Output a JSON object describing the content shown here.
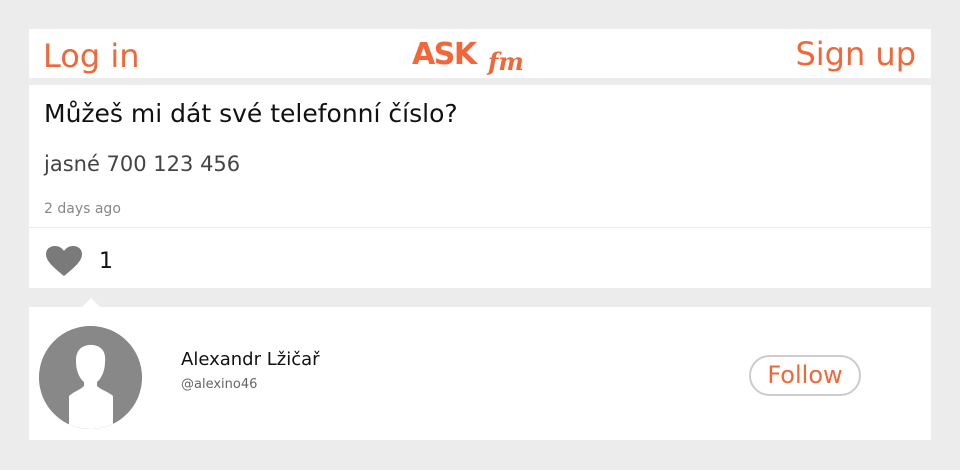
{
  "header": {
    "login_label": "Log in",
    "signup_label": "Sign up",
    "logo_text_ask": "ASK",
    "logo_text_fm": "fm"
  },
  "post": {
    "question": "Můžeš mi dát své telefonní číslo?",
    "answer": "jasné 700 123 456",
    "time_ago": "2 days ago",
    "like_count": "1"
  },
  "user": {
    "name": "Alexandr Lžičař",
    "handle": "@alexino46",
    "follow_label": "Follow"
  },
  "colors": {
    "brand": "#f26739",
    "background": "#ececec",
    "icon_gray": "#7a7a7a"
  },
  "icons": {
    "like": "heart-icon",
    "avatar": "default-avatar-icon"
  }
}
